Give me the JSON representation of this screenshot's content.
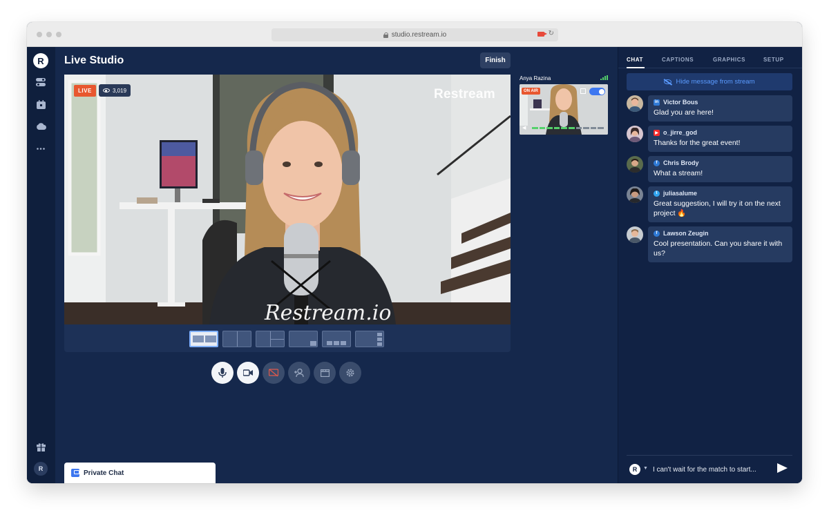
{
  "browser": {
    "url": "studio.restream.io"
  },
  "sidebar": {
    "logo": "R",
    "user_initial": "R"
  },
  "header": {
    "title": "Live Studio",
    "finish_label": "Finish"
  },
  "stream": {
    "live_label": "LIVE",
    "viewers": "3,019",
    "watermark": "Restream",
    "shirt_text": "Restream.io"
  },
  "guest": {
    "name": "Anya Razina",
    "on_air_label": "ON AIR",
    "audio_level": 0.6
  },
  "private_chat": {
    "label": "Private Chat"
  },
  "right_panel": {
    "tabs": [
      "CHAT",
      "CAPTIONS",
      "GRAPHICS",
      "SETUP"
    ],
    "active_tab": "CHAT",
    "hide_label": "Hide message from stream",
    "messages": [
      {
        "author": "Victor Bous",
        "platform": "linkedin",
        "text": "Glad you are here!"
      },
      {
        "author": "o_jirre_god",
        "platform": "youtube",
        "text": "Thanks for the great event!"
      },
      {
        "author": "Chris Brody",
        "platform": "facebook",
        "text": "What a stream!"
      },
      {
        "author": "juliasalume",
        "platform": "twitter",
        "text": "Great suggestion, I will try it on the next project 🔥"
      },
      {
        "author": "Lawson Zeugin",
        "platform": "facebook",
        "text": "Cool presentation. Can you share it with us?"
      }
    ],
    "composer": {
      "avatar": "R",
      "value": "I can't wait for the match to start..."
    }
  },
  "colors": {
    "accent": "#3d77f0",
    "live": "#e8572f",
    "bg": "#15284c",
    "panel": "#112244"
  }
}
